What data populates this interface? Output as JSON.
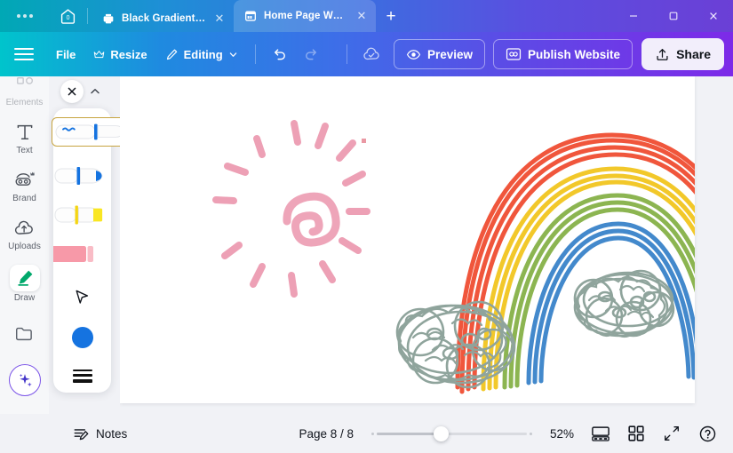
{
  "window": {
    "dots_icon": "more-dots-icon",
    "home_icon": "home-icon",
    "home_badge": "0",
    "minimize_label": "–",
    "maximize_label": "□",
    "close_label": "✕",
    "new_tab_label": "+"
  },
  "tabs": [
    {
      "title": "Black Gradient Ele...",
      "icon": "presentation-icon",
      "close_label": "✕",
      "active": false
    },
    {
      "title": "Home Page Websit...",
      "icon": "browser-window-icon",
      "close_label": "✕",
      "active": true
    }
  ],
  "toolbar": {
    "menu_icon": "hamburger-menu-icon",
    "file_label": "File",
    "resize_label": "Resize",
    "resize_icon": "crown-icon",
    "editing_label": "Editing",
    "editing_icon": "pencil-icon",
    "editing_caret": "chevron-down-icon",
    "undo_icon": "undo-icon",
    "redo_icon": "redo-icon",
    "cloud_icon": "cloud-saved-icon",
    "preview_label": "Preview",
    "preview_icon": "eye-icon",
    "publish_label": "Publish Website",
    "publish_icon": "monitor-icon",
    "share_label": "Share",
    "share_icon": "upload-icon"
  },
  "sidebar": {
    "items": [
      {
        "label": "Elements",
        "icon": "shapes-icon",
        "active": false,
        "faded": true
      },
      {
        "label": "Text",
        "icon": "text-icon",
        "active": false,
        "faded": false
      },
      {
        "label": "Brand",
        "icon": "brand-icon",
        "active": false,
        "faded": false
      },
      {
        "label": "Uploads",
        "icon": "upload-cloud-icon",
        "active": false,
        "faded": false
      },
      {
        "label": "Draw",
        "icon": "draw-pen-icon",
        "active": true,
        "faded": false
      },
      {
        "label": "",
        "icon": "projects-folder-icon",
        "active": false,
        "faded": false
      }
    ],
    "magic_button": {
      "label": "",
      "icon": "magic-sparkle-icon"
    }
  },
  "draw_panel": {
    "close_label": "✕",
    "close_icon": "close-icon",
    "collapse_icon": "chevron-up-icon",
    "tools": [
      {
        "name": "pen",
        "icon": "pen-tool-icon",
        "selected": true,
        "color": "#1573e0"
      },
      {
        "name": "marker",
        "icon": "marker-tool-icon",
        "selected": false,
        "color": "#1573e0"
      },
      {
        "name": "highlighter",
        "icon": "highlighter-tool-icon",
        "selected": false,
        "color": "#f4d514"
      },
      {
        "name": "eraser",
        "icon": "eraser-tool-icon",
        "selected": false,
        "color": "#f799a8"
      }
    ],
    "cursor_icon": "cursor-arrow-icon",
    "color_swatch": {
      "icon": "color-swatch-icon",
      "value": "#1573e0"
    },
    "thickness_icon": "line-thickness-icon",
    "selection_color": "#c7a440"
  },
  "canvas": {
    "artwork": [
      {
        "name": "sun-doodle",
        "color": "#eda0b5"
      },
      {
        "name": "rainbow-doodle",
        "colors": [
          "#f0563c",
          "#f2c82a",
          "#8cb551",
          "#4389cc"
        ]
      },
      {
        "name": "cloud-left-doodle",
        "color": "#8fa49c"
      },
      {
        "name": "cloud-right-doodle",
        "color": "#8fa49c"
      },
      {
        "name": "tiny-mark-doodle",
        "color": "#d8455a"
      }
    ]
  },
  "bottombar": {
    "notes_label": "Notes",
    "notes_icon": "notes-pencil-icon",
    "page_indicator": "Page 8 / 8",
    "zoom_value": "52%",
    "zoom_percent": 52,
    "presenter_icon": "presenter-view-icon",
    "grid_icon": "grid-view-icon",
    "fullscreen_icon": "expand-arrows-icon",
    "help_icon": "help-question-icon"
  },
  "colors": {
    "toolbar_gradient_start": "#00c4cc",
    "toolbar_gradient_mid": "#3d6ee8",
    "toolbar_gradient_end": "#7d2ae8",
    "draw_accent": "#00a86b",
    "selection": "#c7a440",
    "canvas_bg": "#f1f2f6"
  }
}
